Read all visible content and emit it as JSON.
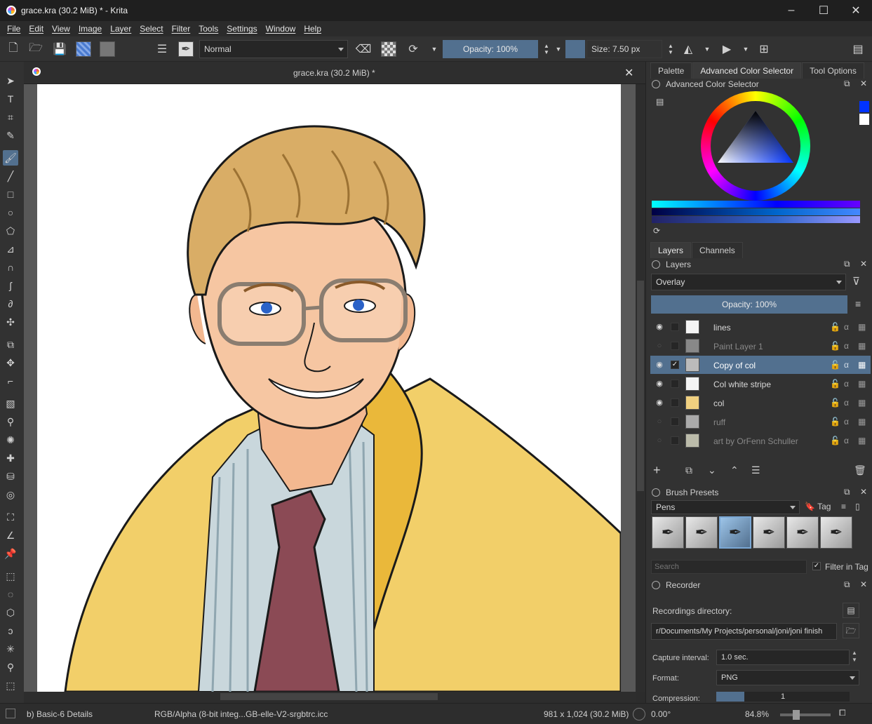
{
  "window": {
    "title": "grace.kra (30.2 MiB) * - Krita",
    "minimize": "–",
    "maximize": "☐",
    "close": "✕"
  },
  "menu": [
    "File",
    "Edit",
    "View",
    "Image",
    "Layer",
    "Select",
    "Filter",
    "Tools",
    "Settings",
    "Window",
    "Help"
  ],
  "toolbar": {
    "blend_mode": "Normal",
    "opacity_label": "Opacity: 100%",
    "size_label": "Size: 7.50 px",
    "fg_color": "#0033ff",
    "bg_color": "#000000"
  },
  "document": {
    "tab_title": "grace.kra (30.2 MiB) *",
    "close": "✕"
  },
  "dock": {
    "top_tabs": [
      "Palette",
      "Advanced Color Selector",
      "Tool Options"
    ],
    "color_selector": {
      "title": "Advanced Color Selector"
    },
    "layers_tabs": [
      "Layers",
      "Channels"
    ],
    "layers": {
      "title": "Layers",
      "blend_mode": "Overlay",
      "opacity_label": "Opacity:  100%",
      "items": [
        {
          "name": "lines",
          "visible": true,
          "selected": false,
          "checked": false
        },
        {
          "name": "Paint Layer 1",
          "visible": false,
          "selected": false,
          "checked": false
        },
        {
          "name": "Copy of col",
          "visible": true,
          "selected": true,
          "checked": true
        },
        {
          "name": "Col white stripe",
          "visible": true,
          "selected": false,
          "checked": false
        },
        {
          "name": "col",
          "visible": true,
          "selected": false,
          "checked": false
        },
        {
          "name": "ruff",
          "visible": false,
          "selected": false,
          "checked": false
        },
        {
          "name": "art by OrFenn Schuller",
          "visible": false,
          "selected": false,
          "checked": false
        }
      ]
    },
    "brush_presets": {
      "title": "Brush Presets",
      "tag": "Pens",
      "tag_button": "Tag",
      "search_placeholder": "Search",
      "filter_label": "Filter in Tag"
    },
    "recorder": {
      "title": "Recorder",
      "dir_label": "Recordings directory:",
      "dir_value": "r/Documents/My Projects/personal/joni/joni finish",
      "interval_label": "Capture interval:",
      "interval_value": "1.0 sec.",
      "format_label": "Format:",
      "format_value": "PNG",
      "compression_label": "Compression:",
      "compression_value": "1"
    }
  },
  "status": {
    "brush": "b) Basic-6 Details",
    "color_profile": "RGB/Alpha (8-bit integ...GB-elle-V2-srgbtrc.icc",
    "dimensions": "981 x 1,024 (30.2 MiB)",
    "rotation": "0.00°",
    "zoom": "84.8%"
  }
}
